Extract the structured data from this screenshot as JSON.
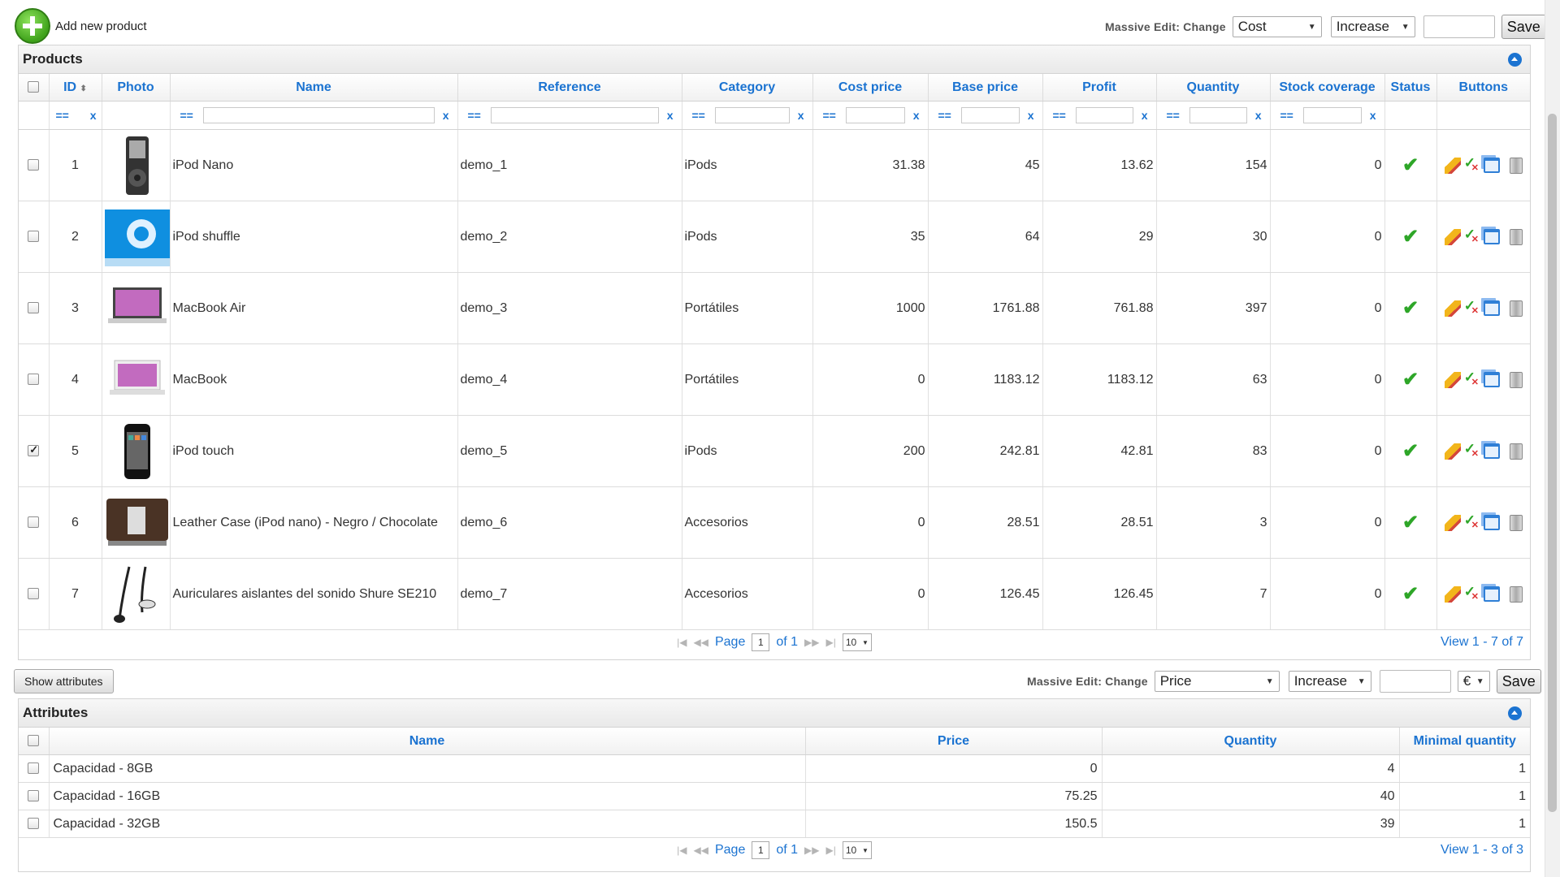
{
  "toolbar": {
    "add_label": "Add new product",
    "massive_label": "Massive Edit: Change",
    "field": "Cost",
    "operation": "Increase",
    "save_label": "Save"
  },
  "products": {
    "title": "Products",
    "columns": [
      "ID",
      "Photo",
      "Name",
      "Reference",
      "Category",
      "Cost price",
      "Base price",
      "Profit",
      "Quantity",
      "Stock coverage",
      "Status",
      "Buttons"
    ],
    "filter_eq": "==",
    "filter_clear": "x",
    "rows": [
      {
        "id": "1",
        "name": "iPod Nano",
        "reference": "demo_1",
        "category": "iPods",
        "cost": "31.38",
        "base": "45",
        "profit": "13.62",
        "qty": "154",
        "coverage": "0",
        "checked": false,
        "photo": "ipod-nano-photo"
      },
      {
        "id": "2",
        "name": "iPod shuffle",
        "reference": "demo_2",
        "category": "iPods",
        "cost": "35",
        "base": "64",
        "profit": "29",
        "qty": "30",
        "coverage": "0",
        "checked": false,
        "photo": "ipod-shuffle-photo"
      },
      {
        "id": "3",
        "name": "MacBook Air",
        "reference": "demo_3",
        "category": "Portátiles",
        "cost": "1000",
        "base": "1761.88",
        "profit": "761.88",
        "qty": "397",
        "coverage": "0",
        "checked": false,
        "photo": "macbook-air-photo"
      },
      {
        "id": "4",
        "name": "MacBook",
        "reference": "demo_4",
        "category": "Portátiles",
        "cost": "0",
        "base": "1183.12",
        "profit": "1183.12",
        "qty": "63",
        "coverage": "0",
        "checked": false,
        "photo": "macbook-photo"
      },
      {
        "id": "5",
        "name": "iPod touch",
        "reference": "demo_5",
        "category": "iPods",
        "cost": "200",
        "base": "242.81",
        "profit": "42.81",
        "qty": "83",
        "coverage": "0",
        "checked": true,
        "photo": "ipod-touch-photo"
      },
      {
        "id": "6",
        "name": "Leather Case (iPod nano) - Negro / Chocolate",
        "reference": "demo_6",
        "category": "Accesorios",
        "cost": "0",
        "base": "28.51",
        "profit": "28.51",
        "qty": "3",
        "coverage": "0",
        "checked": false,
        "photo": "leather-case-photo"
      },
      {
        "id": "7",
        "name": "Auriculares aislantes del sonido Shure SE210",
        "reference": "demo_7",
        "category": "Accesorios",
        "cost": "0",
        "base": "126.45",
        "profit": "126.45",
        "qty": "7",
        "coverage": "0",
        "checked": false,
        "photo": "earphones-photo"
      }
    ],
    "pager": {
      "page_label": "Page",
      "page": "1",
      "of_label": "of 1",
      "per_page": "10",
      "view": "View 1 - 7 of 7"
    }
  },
  "attr_toolbar": {
    "show_label": "Show attributes",
    "massive_label": "Massive Edit: Change",
    "field": "Price",
    "operation": "Increase",
    "currency": "€",
    "save_label": "Save"
  },
  "attributes": {
    "title": "Attributes",
    "columns": [
      "Name",
      "Price",
      "Quantity",
      "Minimal quantity"
    ],
    "rows": [
      {
        "name": "Capacidad - 8GB",
        "price": "0",
        "qty": "4",
        "min": "1"
      },
      {
        "name": "Capacidad - 16GB",
        "price": "75.25",
        "qty": "40",
        "min": "1"
      },
      {
        "name": "Capacidad - 32GB",
        "price": "150.5",
        "qty": "39",
        "min": "1"
      }
    ],
    "pager": {
      "page_label": "Page",
      "page": "1",
      "of_label": "of 1",
      "per_page": "10",
      "view": "View 1 - 3 of 3"
    }
  }
}
